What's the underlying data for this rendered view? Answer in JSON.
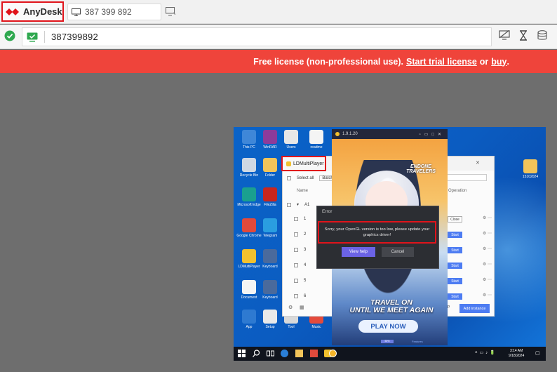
{
  "app": {
    "name": "AnyDesk",
    "accent": "#ef443b"
  },
  "tab": {
    "label": "387 399 892"
  },
  "address": {
    "value": "387399892"
  },
  "license": {
    "prefix": "Free license (non-professional use).",
    "trial_link": "Start trial license",
    "or": "or",
    "buy_link": "buy",
    "suffix": "."
  },
  "remote": {
    "desktop_icons": [
      {
        "label": "This PC",
        "color": "#3f87d8"
      },
      {
        "label": "WinRAR",
        "color": "#8d3b9a"
      },
      {
        "label": "Users",
        "color": "#e7e7e7"
      },
      {
        "label": "readme",
        "color": "#f4f4f4"
      },
      {
        "label": "Recycle Bin",
        "color": "#cfd8e3"
      },
      {
        "label": "Folder",
        "color": "#f2c45a"
      },
      {
        "label": "Microsoft Edge",
        "color": "#1aa08f"
      },
      {
        "label": "FileZilla",
        "color": "#c9261d"
      },
      {
        "label": "Google Chrome",
        "color": "#e24a3b"
      },
      {
        "label": "Telegram",
        "color": "#2a9ee0"
      },
      {
        "label": "LDMultiPlayer",
        "color": "#f2c12e"
      },
      {
        "label": "Keyboard",
        "color": "#4a6a9c"
      },
      {
        "label": "Document",
        "color": "#f4f4f4"
      },
      {
        "label": "Keyboard",
        "color": "#4a6a9c"
      },
      {
        "label": "App",
        "color": "#2e7ad1"
      },
      {
        "label": "Setup",
        "color": "#e9e9e9"
      },
      {
        "label": "Tool",
        "color": "#d9d9d9"
      },
      {
        "label": "Music",
        "color": "#e44a3c"
      },
      {
        "label": "15102024",
        "color": "#f2c45a"
      }
    ],
    "ldm": {
      "title": "LDMultiPlayer",
      "select_all": "Select all",
      "batch": "Batch",
      "col_name": "Name",
      "col_operation": "Operation",
      "group": "A1",
      "rows": [
        "1",
        "2",
        "3",
        "4",
        "5",
        "6"
      ],
      "row_actions": [
        "Close",
        "Start",
        "Start",
        "Start",
        "Start",
        "Start"
      ],
      "add_instance": "Add instance",
      "backup": "up"
    },
    "game": {
      "version": "1.9.1.20",
      "logo": "ENDONE TRAVELERS",
      "slogan_line1": "TRAVEL ON",
      "slogan_line2": "UNTIL WE MEET AGAIN",
      "play_button": "PLAY NOW",
      "progress_badge": "50%",
      "progress_value": 50,
      "link": "Features"
    },
    "error": {
      "title": "Error",
      "message": "Sorry, your OpenGL version is too low, please update your graphics driver!",
      "help_button": "View help",
      "cancel_button": "Cancel"
    },
    "clock": {
      "time": "3:14 AM",
      "date": "9/18/2024"
    }
  }
}
